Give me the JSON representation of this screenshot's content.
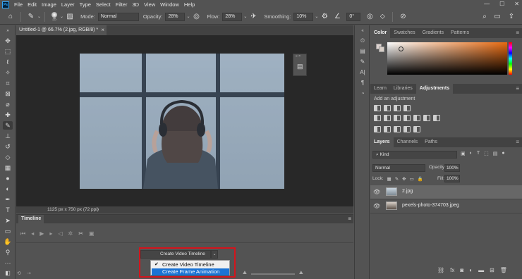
{
  "menubar": {
    "items": [
      "File",
      "Edit",
      "Image",
      "Layer",
      "Type",
      "Select",
      "Filter",
      "3D",
      "View",
      "Window",
      "Help"
    ]
  },
  "options": {
    "brush_size": "35",
    "mode_label": "Mode:",
    "mode_value": "Normal",
    "opacity_label": "Opacity:",
    "opacity_value": "28%",
    "flow_label": "Flow:",
    "flow_value": "28%",
    "smoothing_label": "Smoothing:",
    "smoothing_value": "10%",
    "angle_value": "0°"
  },
  "document": {
    "tab_title": "Untitled-1 @ 66.7% (2.jpg, RGB/8) *",
    "status": "1125 px x 750 px (72 ppi)"
  },
  "timeline": {
    "title": "Timeline",
    "create_button": "Create Video Timeline",
    "options": [
      {
        "label": "Create Video Timeline",
        "checked": true
      },
      {
        "label": "Create Frame Animation",
        "selected": true
      }
    ]
  },
  "color_panel": {
    "tabs": [
      "Color",
      "Swatches",
      "Gradients",
      "Patterns"
    ],
    "active": "Color"
  },
  "adjust_panel": {
    "tabs": [
      "Learn",
      "Libraries",
      "Adjustments"
    ],
    "active": "Adjustments",
    "add_label": "Add an adjustment"
  },
  "layers_panel": {
    "tabs": [
      "Layers",
      "Channels",
      "Paths"
    ],
    "active": "Layers",
    "filter_kind": "Kind",
    "blend_mode": "Normal",
    "opacity_label": "Opacity:",
    "opacity_value": "100%",
    "lock_label": "Lock:",
    "fill_label": "Fill:",
    "fill_value": "100%",
    "layers": [
      {
        "name": "2.jpg"
      },
      {
        "name": "pexels-photo-374703.jpeg"
      }
    ]
  }
}
